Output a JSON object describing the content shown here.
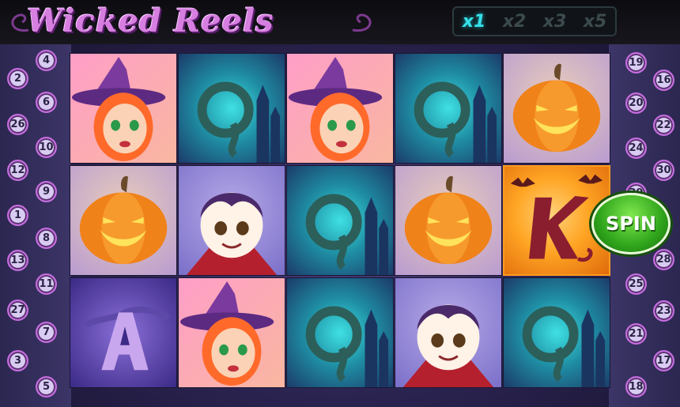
{
  "game": {
    "title": "Wicked Reels",
    "spin_label": "SPIN"
  },
  "multipliers": {
    "options": [
      "x1",
      "x2",
      "x3",
      "x5"
    ],
    "active": "x1"
  },
  "paylines": {
    "left_outer": [
      "2",
      "26",
      "12",
      "1",
      "13",
      "27",
      "3"
    ],
    "left_inner": [
      "4",
      "6",
      "10",
      "9",
      "8",
      "11",
      "7",
      "5"
    ],
    "right_inner": [
      "19",
      "20",
      "24",
      "29",
      "25",
      "21",
      "18"
    ],
    "right_outer": [
      "16",
      "22",
      "30",
      "28",
      "23",
      "17"
    ]
  },
  "reels": {
    "rows": [
      [
        "witch",
        "Q",
        "witch",
        "Q",
        "pumpkin"
      ],
      [
        "pumpkin",
        "vampire",
        "Q",
        "pumpkin",
        "K"
      ],
      [
        "A",
        "witch",
        "Q",
        "vampire",
        "Q"
      ]
    ]
  },
  "colors": {
    "accent": "#35e0e8",
    "spin_green": "#2fa41b",
    "logo_purple": "#d77fe0",
    "badge_border": "#c76ee0"
  }
}
